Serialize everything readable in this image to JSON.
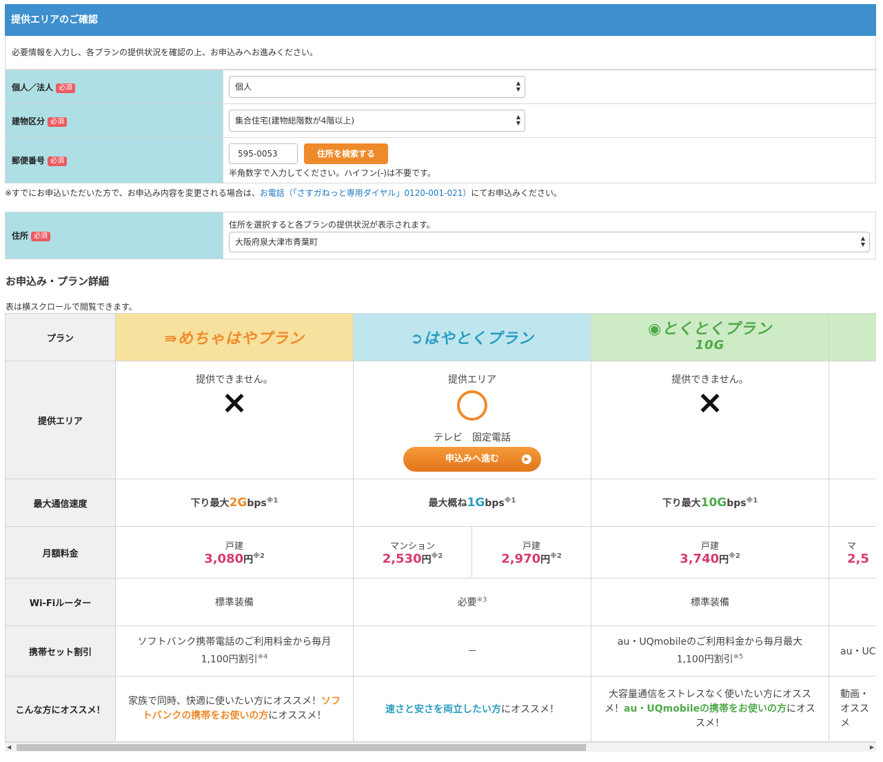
{
  "header": {
    "title": "提供エリアのご確認"
  },
  "intro": "必要情報を入力し、各プランの提供状況を確認の上、お申込みへお進みください。",
  "required_badge": "必須",
  "form": {
    "type_label": "個人／法人",
    "type_value": "個人",
    "building_label": "建物区分",
    "building_value": "集合住宅(建物総階数が4階以上)",
    "postal_label": "郵便番号",
    "postal_value": "595-0053",
    "search_button": "住所を検索する",
    "postal_hint": "半角数字で入力してください。ハイフン(-)は不要です。",
    "address_label": "住所",
    "address_hint": "住所を選択すると各プランの提供状況が表示されます。",
    "address_value": "大阪府泉大津市青葉町"
  },
  "notice": {
    "pre": "※すでにお申込いただいた方で、お申込み内容を変更される場合は、",
    "link": "お電話（「さすガねっと専用ダイヤル」0120-001-021）",
    "post": "にてお申込みください。"
  },
  "section_title": "お申込み・プラン詳細",
  "scroll_note": "表は横スクロールで閲覧できます。",
  "rows": {
    "plan": "プラン",
    "area": "提供エリア",
    "speed": "最大通信速度",
    "fee": "月額料金",
    "router": "Wi-Fiルーター",
    "set": "携帯セット割引",
    "rec": "こんな方にオススメ！"
  },
  "colors": {
    "header": "#3d8fce",
    "label_bg": "#addfe4",
    "mecha": "#f7e19e",
    "hayatoku": "#bfe6ef",
    "tokutoku": "#cdebc5",
    "orange": "#ef8a2a",
    "pink": "#d83a6b",
    "green": "#4fa94a"
  },
  "plans": [
    {
      "name": "めちゃはやプラン",
      "area_text": "提供できません。",
      "area_mark": "×",
      "speed_pre": "下り最大",
      "speed_num": "2G",
      "speed_unit": "bps",
      "speed_note": "※1",
      "fee_type": "戸建",
      "fee_price": "3,080",
      "fee_unit": "円",
      "fee_note": "※2",
      "router": "標準装備",
      "set_text": "ソフトバンク携帯電話のご利用料金から毎月1,100円割引",
      "set_note": "※4",
      "rec_pre": "家族で同時、快適に使いたい方にオススメ！",
      "rec_hl": "ソフトバンクの携帯をお使いの方",
      "rec_post": "にオススメ！"
    },
    {
      "name": "はやとくプラン",
      "area_text": "提供エリア",
      "area_mark": "○",
      "services": "テレビ　固定電話",
      "apply_button": "申込みへ進む",
      "speed_pre": "最大概ね",
      "speed_num": "1G",
      "speed_unit": "bps",
      "speed_note": "※1",
      "fee_a_type": "マンション",
      "fee_a_price": "2,530",
      "fee_b_type": "戸建",
      "fee_b_price": "2,970",
      "fee_unit": "円",
      "fee_note": "※2",
      "router": "必要",
      "router_note": "※3",
      "set_text": "－",
      "rec_hl": "速さと安さを両立したい方",
      "rec_post": "にオススメ！"
    },
    {
      "name": "とくとくプラン",
      "name_sub": "10G",
      "area_text": "提供できません。",
      "area_mark": "×",
      "speed_pre": "下り最大",
      "speed_num": "10G",
      "speed_unit": "bps",
      "speed_note": "※1",
      "fee_type": "戸建",
      "fee_price": "3,740",
      "fee_unit": "円",
      "fee_note": "※2",
      "router": "標準装備",
      "set_text": "au・UQmobileのご利用料金から毎月最大1,100円割引",
      "set_note": "※5",
      "rec_pre": "大容量通信をストレスなく使いたい方にオススメ！",
      "rec_hl": "au・UQmobileの携帯をお使いの方",
      "rec_post": "にオススメ！"
    },
    {
      "fee_type": "マ",
      "fee_price": "2,5",
      "set_text": "au・UC",
      "rec_text": "動画・オススメ"
    }
  ]
}
